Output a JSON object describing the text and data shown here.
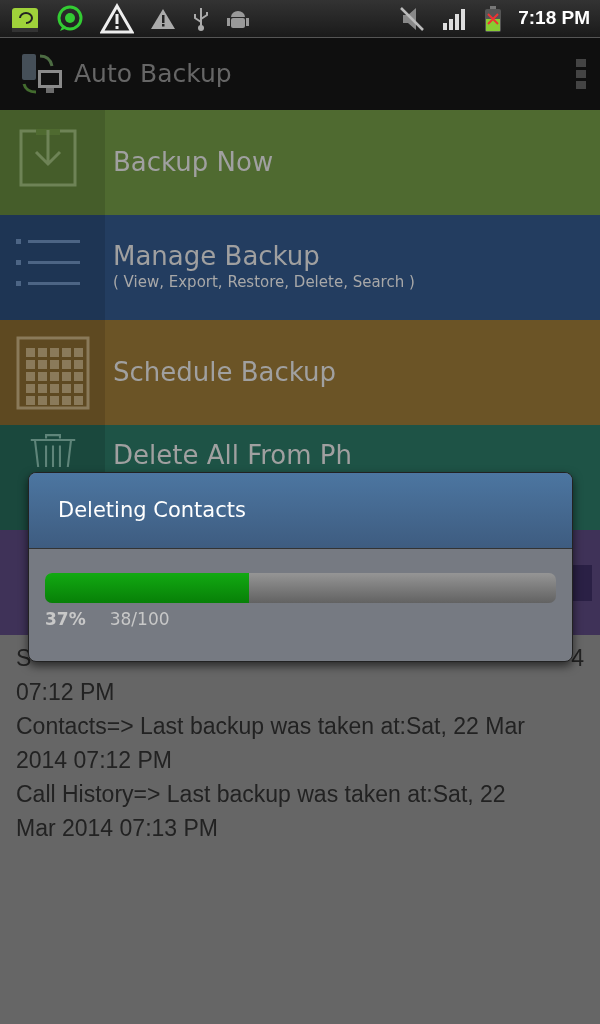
{
  "status_bar": {
    "time": "7:18 PM"
  },
  "app_bar": {
    "title": "Auto Backup"
  },
  "menu": [
    {
      "kind": "download",
      "label": "Backup Now",
      "color": "#4f6a30"
    },
    {
      "kind": "list",
      "label": "Manage Backup",
      "sublabel": "( View, Export, Restore, Delete, Search )",
      "color": "#233d60"
    },
    {
      "kind": "calendar",
      "label": "Schedule Backup",
      "color": "#6b5426"
    },
    {
      "kind": "trash",
      "label": "Delete All From Ph",
      "color": "#1e5346"
    },
    {
      "kind": "button",
      "color": "#3f3258"
    }
  ],
  "backup_status": [
    {
      "start": "S",
      "end": "4",
      "rest": "07:12 PM"
    },
    {
      "text": "Contacts=> Last backup was taken at:Sat, 22 Mar 2014 07:12 PM"
    },
    {
      "text": "Call History=> Last backup was taken at:Sat, 22 Mar 2014 07:13 PM"
    }
  ],
  "dialog": {
    "title": "Deleting Contacts",
    "level": 0.4,
    "percent": "37%",
    "count": "38/100"
  }
}
